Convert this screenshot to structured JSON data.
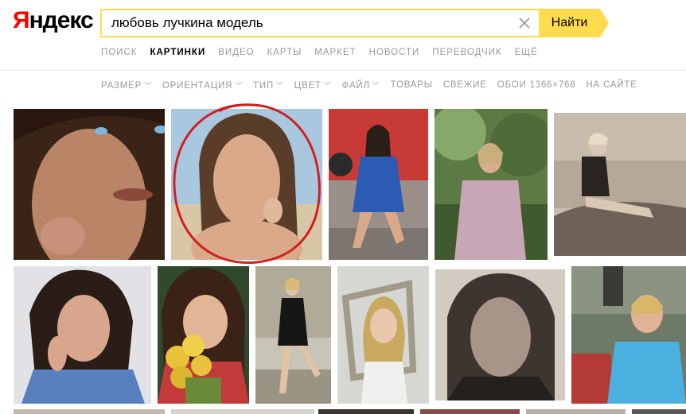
{
  "logo": {
    "first": "Я",
    "rest": "ндекс"
  },
  "search": {
    "query": "любовь лучкина модель",
    "button_label": "Найти"
  },
  "services": [
    {
      "label": "Поиск",
      "active": false
    },
    {
      "label": "Картинки",
      "active": true
    },
    {
      "label": "Видео",
      "active": false
    },
    {
      "label": "Карты",
      "active": false
    },
    {
      "label": "Маркет",
      "active": false
    },
    {
      "label": "Новости",
      "active": false
    },
    {
      "label": "Переводчик",
      "active": false
    },
    {
      "label": "Ещё",
      "active": false
    }
  ],
  "filters": [
    {
      "label": "Размер",
      "dropdown": true
    },
    {
      "label": "Ориентация",
      "dropdown": true
    },
    {
      "label": "Тип",
      "dropdown": true
    },
    {
      "label": "Цвет",
      "dropdown": true
    },
    {
      "label": "Файл",
      "dropdown": true
    },
    {
      "label": "Товары",
      "dropdown": false
    },
    {
      "label": "Свежие",
      "dropdown": false
    },
    {
      "label": "Обои 1366×768",
      "dropdown": false
    },
    {
      "label": "На сайте",
      "dropdown": false
    }
  ],
  "colors": {
    "accent": "#ffdb4d",
    "logo_red": "#ff0000",
    "highlight_circle": "#d21f1f"
  },
  "results": [
    {
      "name": "image-woman-closeup-blue-eyes"
    },
    {
      "name": "image-woman-beach-highlighted",
      "highlighted": true
    },
    {
      "name": "image-woman-blue-dress-red-car"
    },
    {
      "name": "image-woman-pink-dress-trees"
    },
    {
      "name": "image-woman-sitting-rocks-sepia"
    },
    {
      "name": "image-woman-blue-shirt-smiling"
    },
    {
      "name": "image-girl-yellow-roses"
    },
    {
      "name": "image-woman-black-dress-stairs"
    },
    {
      "name": "image-woman-holding-frame"
    },
    {
      "name": "image-woman-portrait-bw"
    },
    {
      "name": "image-woman-blue-top-outdoors"
    }
  ]
}
